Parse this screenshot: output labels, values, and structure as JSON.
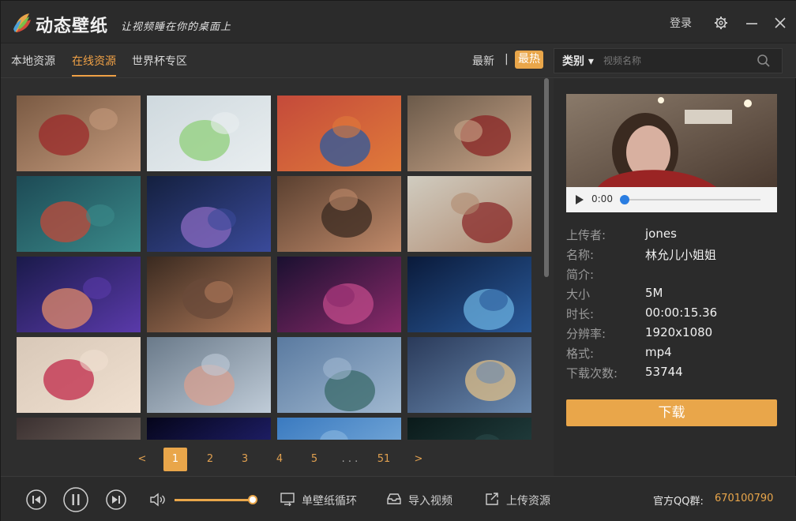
{
  "app": {
    "title": "动态壁纸",
    "slogan": "让视频睡在你的桌面上",
    "login": "登录"
  },
  "nav": {
    "tabs": [
      {
        "label": "本地资源",
        "active": false
      },
      {
        "label": "在线资源",
        "active": true
      },
      {
        "label": "世界杯专区",
        "active": false
      }
    ],
    "sort_latest": "最新",
    "sort_separator": "|",
    "sort_hot": "最热",
    "category": "类别 ▾",
    "search_placeholder": "视频名称"
  },
  "thumbnails": [
    {
      "name": "girl-red-hoodie-selfie",
      "colors": [
        "#7a5a43",
        "#c49a7c",
        "#9b2a2a"
      ]
    },
    {
      "name": "angry-birds-chicks-snow",
      "colors": [
        "#cfd9de",
        "#e9eef0",
        "#8fcf7a"
      ]
    },
    {
      "name": "girl-orange-shirt-triple",
      "colors": [
        "#c44a3a",
        "#e07a3a",
        "#2a5aa0"
      ]
    },
    {
      "name": "girl-red-hoodie-room",
      "colors": [
        "#6b5a4a",
        "#c9a588",
        "#8a2424"
      ]
    },
    {
      "name": "ocean-wave-fantasy",
      "colors": [
        "#1d4a55",
        "#3a8a8a",
        "#c04a3a"
      ]
    },
    {
      "name": "starry-sky-silhouette",
      "colors": [
        "#14203f",
        "#3a4a9a",
        "#8a6ac0"
      ]
    },
    {
      "name": "girl-hand-on-face",
      "colors": [
        "#5a4030",
        "#c08a6a",
        "#3a2a20"
      ]
    },
    {
      "name": "girl-red-dress-pose",
      "colors": [
        "#d0ccc0",
        "#b08a70",
        "#8a2a2a"
      ]
    },
    {
      "name": "comet-sky-couple",
      "colors": [
        "#1a1a4a",
        "#5a3aaa",
        "#e08a6a"
      ]
    },
    {
      "name": "movie-scene-woman",
      "colors": [
        "#3a2a20",
        "#b07a5a",
        "#6a4a3a"
      ]
    },
    {
      "name": "purple-tree-night",
      "colors": [
        "#1a1030",
        "#8a2a6a",
        "#c04a8a"
      ]
    },
    {
      "name": "blue-crystal-night",
      "colors": [
        "#0a1a3a",
        "#2a5a9a",
        "#6ab0e0"
      ]
    },
    {
      "name": "pug-dog-closeup",
      "colors": [
        "#d8c8b8",
        "#f0e0d0",
        "#c02a4a"
      ]
    },
    {
      "name": "anime-girl-white-hair",
      "colors": [
        "#6a7a8a",
        "#c0ccd8",
        "#d8a090"
      ]
    },
    {
      "name": "mountain-lake-landscape",
      "colors": [
        "#5a7aa0",
        "#a0b8d0",
        "#3a6a6a"
      ]
    },
    {
      "name": "anime-girl-hat-lanterns",
      "colors": [
        "#2a3a5a",
        "#6a8ab0",
        "#e0c08a"
      ]
    },
    {
      "name": "anime-girl-dark",
      "colors": [
        "#3a3030",
        "#8a7a70",
        "#1a1a2a"
      ]
    },
    {
      "name": "comet-night-blue",
      "colors": [
        "#05051a",
        "#2a2a8a",
        "#8a6ae0"
      ]
    },
    {
      "name": "blue-sky-clouds",
      "colors": [
        "#3a7ac0",
        "#8ab8e0",
        "#f0f0f0"
      ]
    },
    {
      "name": "starry-teal-sky",
      "colors": [
        "#0a1a1a",
        "#2a4a4a",
        "#6a9a8a"
      ]
    }
  ],
  "pager": {
    "prev": "<",
    "pages": [
      "1",
      "2",
      "3",
      "4",
      "5"
    ],
    "active_page": "1",
    "ellipsis": ". . .",
    "last": "51",
    "next": ">"
  },
  "detail": {
    "time": "0:00",
    "progress": 0,
    "rows": [
      {
        "key": "上传者:",
        "value": "jones"
      },
      {
        "key": "名称:",
        "value": "林允儿小姐姐"
      },
      {
        "key": "简介:",
        "value": ""
      },
      {
        "key": "大小",
        "value": "5M"
      },
      {
        "key": "时长:",
        "value": "00:00:15.36"
      },
      {
        "key": "分辨率:",
        "value": "1920x1080"
      },
      {
        "key": "格式:",
        "value": "mp4"
      },
      {
        "key": "下载次数:",
        "value": "53744"
      }
    ],
    "download_label": "下载"
  },
  "bottom": {
    "volume": 0.95,
    "loop_label": "单壁纸循环",
    "import_label": "导入视频",
    "upload_label": "上传资源",
    "qq_label": "官方QQ群:",
    "qq_number": "670100790"
  },
  "colors": {
    "accent": "#e9a64a",
    "background": "#2e2e2e"
  }
}
